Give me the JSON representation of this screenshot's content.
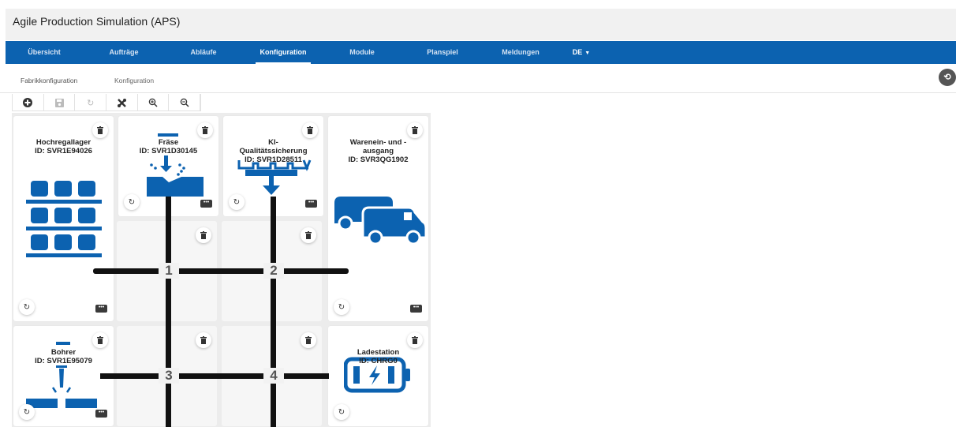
{
  "app": {
    "title": "Agile Production Simulation (APS)"
  },
  "nav": {
    "items": [
      "Übersicht",
      "Aufträge",
      "Abläufe",
      "Konfiguration",
      "Module",
      "Planspiel",
      "Meldungen"
    ],
    "language": "DE",
    "active": "Konfiguration"
  },
  "subtabs": {
    "items": [
      "Fabrikkonfiguration",
      "Konfiguration"
    ],
    "active": "Fabrikkonfiguration"
  },
  "toolbar": {
    "icons": [
      "plus-circle-icon",
      "save-icon",
      "refresh-icon",
      "swap-icon",
      "zoom-in-icon",
      "zoom-out-icon"
    ]
  },
  "modules": {
    "hbw": {
      "name": "Hochregallager",
      "id": "ID: SVR1E94026"
    },
    "mill": {
      "name": "Fräse",
      "id": "ID: SVR1D30145"
    },
    "aiqs": {
      "name_line1": "KI-",
      "name_line2": "Qualitätssicherung",
      "id": "ID: SVR1D28511"
    },
    "dps": {
      "name_line1": "Warenein- und -",
      "name_line2": "ausgang",
      "id": "ID: SVR3QG1902"
    },
    "drill": {
      "name": "Bohrer",
      "id": "ID: SVR1E95079"
    },
    "charger": {
      "name": "Ladestation",
      "id": "ID: CHRG0"
    }
  },
  "intersections": [
    "1",
    "2",
    "3",
    "4"
  ],
  "colors": {
    "brand": "#0c62b0",
    "road": "#111111",
    "module_icon": "#0c62b0"
  }
}
